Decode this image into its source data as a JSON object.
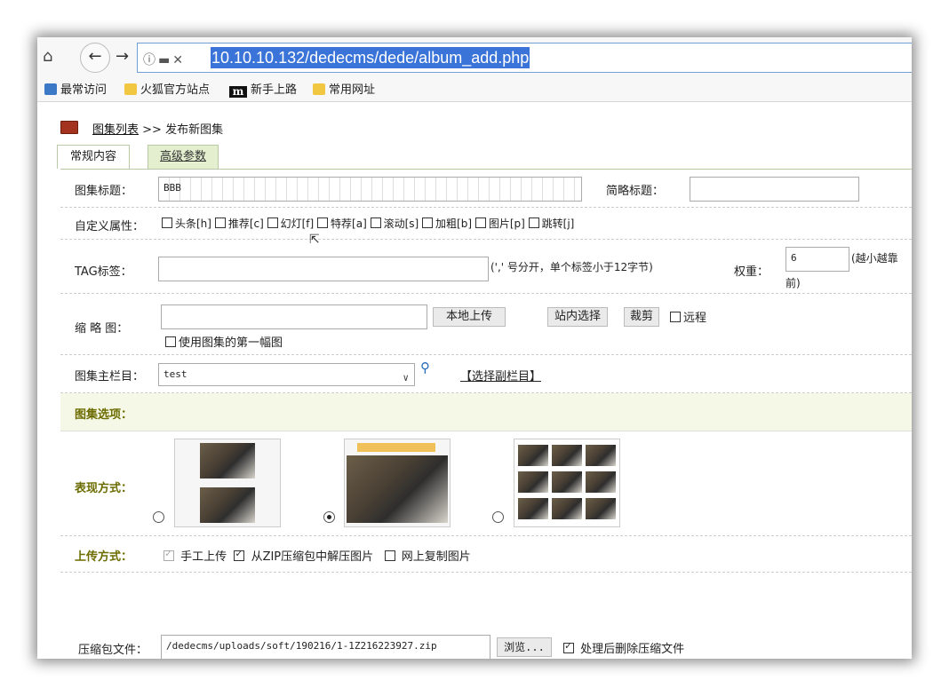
{
  "browser": {
    "url": "10.10.10.132/dedecms/dede/album_add.php",
    "bookmarks": [
      "最常访问",
      "火狐官方站点",
      "新手上路",
      "常用网址"
    ]
  },
  "breadcrumb": {
    "link": "图集列表",
    "sep": ">>",
    "current": "发布新图集"
  },
  "tabs": [
    "常规内容",
    "高级参数"
  ],
  "form": {
    "title_label": "图集标题：",
    "title_value": "BBB",
    "short_title_label": "简略标题：",
    "custom_attr_label": "自定义属性：",
    "attrs": [
      "头条[h]",
      "推荐[c]",
      "幻灯[f]",
      "特荐[a]",
      "滚动[s]",
      "加粗[b]",
      "图片[p]",
      "跳转[j]"
    ],
    "tag_label": "TAG标签：",
    "tag_hint": "(',' 号分开，单个标签小于12字节)",
    "weight_label": "权重：",
    "weight_value": "6",
    "weight_hint_1": "(越小越靠",
    "weight_hint_2": "前)",
    "thumb_label": "缩 略 图：",
    "btn_local_upload": "本地上传",
    "btn_site_select": "站内选择",
    "btn_crop": "裁剪",
    "remote_label": "远程",
    "use_first_label": "使用图集的第一幅图",
    "column_label": "图集主栏目：",
    "column_value": "test",
    "sub_column_link": "【选择副栏目】",
    "album_options_label": "图集选项：",
    "display_mode_label": "表现方式：",
    "upload_mode_label": "上传方式：",
    "upload_manual": "手工上传",
    "upload_zip": "从ZIP压缩包中解压图片",
    "upload_web": "网上复制图片",
    "zip_label": "压缩包文件：",
    "zip_value": "/dedecms/uploads/soft/190216/1-1Z216223927.zip",
    "btn_browse": "浏览...",
    "delete_after_label": "处理后删除压缩文件"
  }
}
